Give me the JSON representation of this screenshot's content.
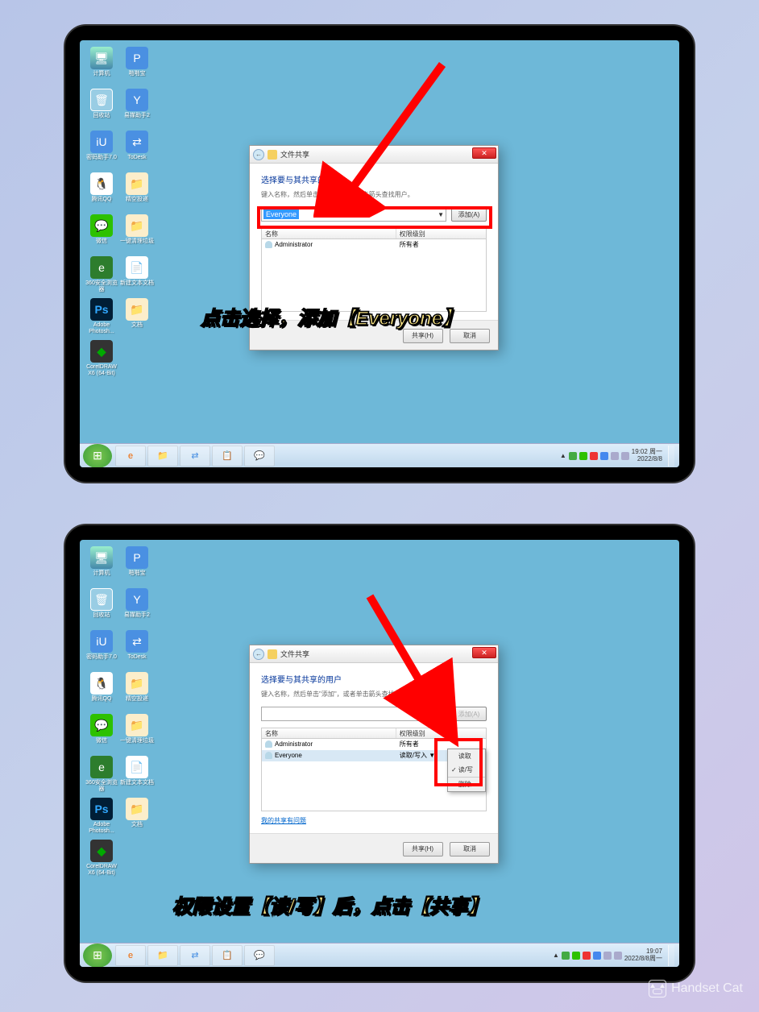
{
  "watermark": "Handset Cat",
  "desktop_icons": [
    {
      "name": "computer",
      "cls": "ic-computer",
      "label": "计算机",
      "glyph": "🖥"
    },
    {
      "name": "papasou",
      "cls": "ic-papa",
      "label": "啪啪宝",
      "glyph": "P"
    },
    {
      "name": "recycle",
      "cls": "ic-recycle",
      "label": "回收站",
      "glyph": "🗑"
    },
    {
      "name": "yimei",
      "cls": "ic-yimei",
      "label": "易媒助手2",
      "glyph": "Y"
    },
    {
      "name": "mima",
      "cls": "ic-iu",
      "label": "密码助手7.0",
      "glyph": "iU"
    },
    {
      "name": "todesk",
      "cls": "ic-todesk",
      "label": "ToDesk",
      "glyph": "⇄"
    },
    {
      "name": "qq",
      "cls": "ic-qq",
      "label": "腾讯QQ",
      "glyph": "🐧"
    },
    {
      "name": "jingkong",
      "cls": "ic-jingkong",
      "label": "精空投递",
      "glyph": "📁"
    },
    {
      "name": "wechat",
      "cls": "ic-wechat",
      "label": "微信",
      "glyph": "💬"
    },
    {
      "name": "yijian",
      "cls": "ic-folder",
      "label": "一键清理垃圾",
      "glyph": "📁"
    },
    {
      "name": "360",
      "cls": "ic-ie",
      "label": "360安全浏览器",
      "glyph": "e"
    },
    {
      "name": "newtxt",
      "cls": "ic-txt",
      "label": "新建文本文档",
      "glyph": "📄"
    },
    {
      "name": "ps",
      "cls": "ic-ps",
      "label": "Adobe Photosh...",
      "glyph": "Ps"
    },
    {
      "name": "docs",
      "cls": "ic-folder",
      "label": "文档",
      "glyph": "📁"
    },
    {
      "name": "cdr",
      "cls": "ic-cdr",
      "label": "CorelDRAW X6 (64-Bit)",
      "glyph": "◆"
    }
  ],
  "dialog": {
    "title": "文件共享",
    "heading": "选择要与其共享的用户",
    "subtext": "键入名称，然后单击\"添加\"，或者单击箭头查找用户。",
    "combo_value": "Everyone",
    "add_btn": "添加(A)",
    "col_name": "名称",
    "col_perm": "权限级别",
    "row_admin": "Administrator",
    "row_admin_perm": "所有者",
    "row_everyone": "Everyone",
    "row_everyone_perm": "读取/写入",
    "trouble": "我的共享有问题",
    "share_btn": "共享(H)",
    "cancel_btn": "取消"
  },
  "perm_menu": {
    "read": "读取",
    "readwrite": "读/写",
    "remove": "删除"
  },
  "taskbar": {
    "time": "19:02 周一",
    "date": "2022/8/8",
    "time2": "19:07",
    "date2": "2022/8/8周一"
  },
  "captions": {
    "top": "点击选择，添加【Everyone】",
    "bottom": "权限设置【读/写】后，点击【共享】"
  }
}
